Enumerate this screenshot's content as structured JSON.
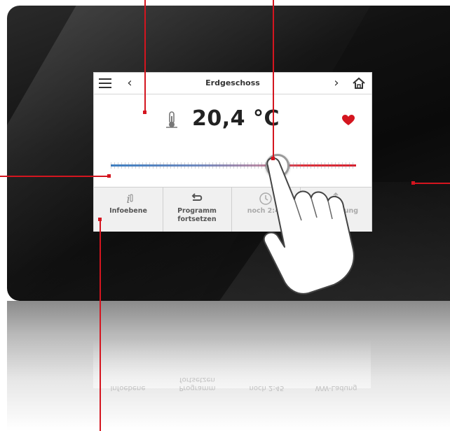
{
  "screen": {
    "title": "Erdgeschoss",
    "temperature": "20,4 °C",
    "favorite": true,
    "slider_level": 0.68
  },
  "tabs": [
    {
      "label": "Infoebene",
      "icon": "info-thermometer-icon"
    },
    {
      "label": "Programm\nfortsetzen",
      "icon": "return-arrow-icon"
    },
    {
      "label": "noch 2:45",
      "icon": "timer-icon"
    },
    {
      "label": "WW-Ladung",
      "icon": "hot-water-icon"
    }
  ],
  "reflection_tabs": [
    {
      "label": "Infoebene"
    },
    {
      "label": "Programm\nfortsetzen"
    },
    {
      "label": "noch 2:45"
    },
    {
      "label": "WW-Ladung"
    }
  ],
  "colors": {
    "callout": "#d4151f",
    "slider_cold": "#3a7fc4",
    "slider_hot": "#d81e2c",
    "heart": "#d4151f"
  }
}
